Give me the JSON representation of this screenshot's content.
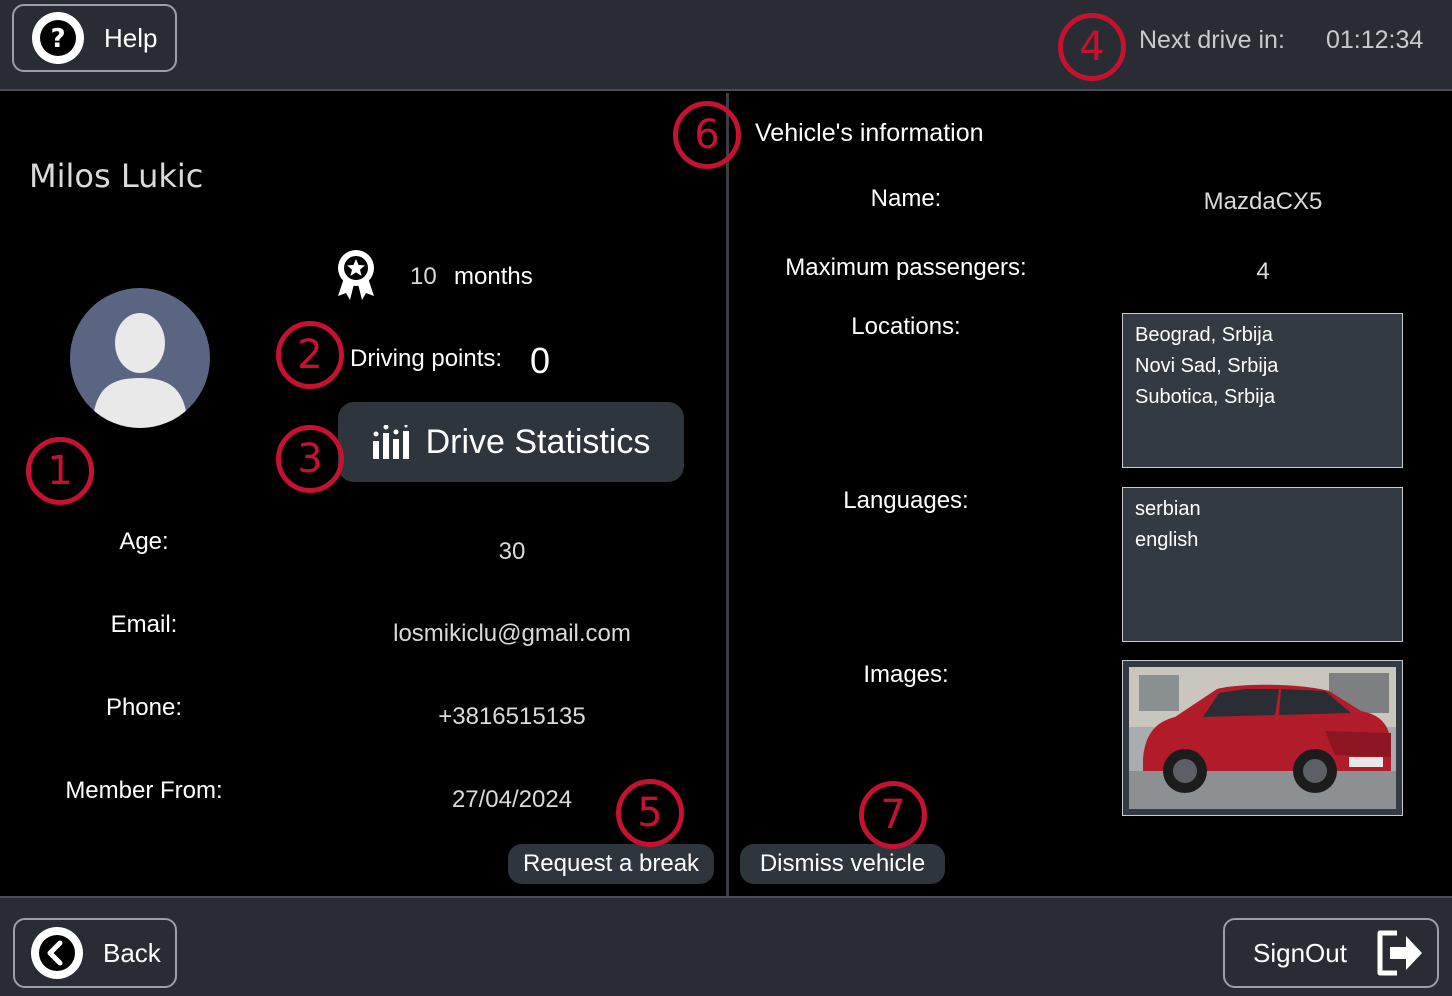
{
  "header": {
    "help_label": "Help",
    "next_drive_label": "Next drive in:",
    "next_drive_time": "01:12:34"
  },
  "profile": {
    "name": "Milos Lukic",
    "tenure_value": "10",
    "tenure_unit": "months",
    "driving_points_label": "Driving points:",
    "driving_points_value": "0",
    "drive_statistics_label": "Drive Statistics",
    "fields": {
      "age_label": "Age:",
      "age_value": "30",
      "email_label": "Email:",
      "email_value": "losmikiclu@gmail.com",
      "phone_label": "Phone:",
      "phone_value": "+3816515135",
      "member_label": "Member From:",
      "member_value": "27/04/2024"
    },
    "request_break_label": "Request a break"
  },
  "vehicle": {
    "title": "Vehicle's information",
    "name_label": "Name:",
    "name_value": "MazdaCX5",
    "passengers_label": "Maximum passengers:",
    "passengers_value": "4",
    "locations_label": "Locations:",
    "locations": [
      "Beograd, Srbija",
      "Novi Sad, Srbija",
      "Subotica, Srbija"
    ],
    "languages_label": "Languages:",
    "languages": [
      "serbian",
      "english"
    ],
    "images_label": "Images:",
    "dismiss_label": "Dismiss vehicle"
  },
  "footer": {
    "back_label": "Back",
    "signout_label": "SignOut"
  },
  "markers": [
    "1",
    "2",
    "3",
    "4",
    "5",
    "6",
    "7"
  ],
  "colors": {
    "background": "#000000",
    "bar": "#292d33",
    "button": "#2f353d",
    "marker": "#c41230",
    "avatar": "#5a6582"
  }
}
